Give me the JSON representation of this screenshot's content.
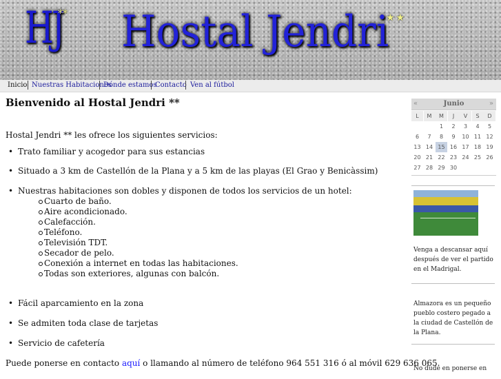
{
  "header": {
    "logo_mark": "HJ",
    "logo_stars": "**",
    "title": "Hostal Jendri",
    "title_stars": "★★"
  },
  "nav": {
    "items": [
      {
        "label": "Inicio",
        "current": true
      },
      {
        "label": "Nuestras Habitaciones",
        "current": false
      },
      {
        "label": "Dónde estamos",
        "current": false
      },
      {
        "label": "Contacto",
        "current": false
      },
      {
        "label": "Ven al fútbol",
        "current": false
      }
    ]
  },
  "main": {
    "title": "Bienvenido al Hostal Jendri **",
    "intro": "Hostal Jendri ** les ofrece los siguientes servicios:",
    "services": [
      "Trato familiar y acogedor para sus estancias",
      "Situado a 3 km de Castellón de la Plana y a 5 km de las playas (El Grao y Benicàssim)",
      "Nuestras habitaciones son dobles y disponen de todos los servicios de un hotel:",
      "Fácil aparcamiento en la zona",
      "Se admiten toda clase de tarjetas",
      "Servicio de cafetería"
    ],
    "room_features": [
      "Cuarto de baño.",
      "Aire acondicionado.",
      "Calefacción.",
      "Teléfono.",
      "Televisión TDT.",
      "Secador de pelo.",
      "Conexión a internet en todas las habitaciones.",
      "Todas son exteriores, algunas con balcón."
    ],
    "contact_before": "Puede ponerse en contacto ",
    "contact_link": "aquí",
    "contact_after": " o llamando al número de teléfono 964 551 316 ó al móvil 629 636 065."
  },
  "calendar": {
    "prev": "«",
    "next": "»",
    "month": "Junio",
    "weekdays": [
      "L",
      "M",
      "M",
      "J",
      "V",
      "S",
      "D"
    ],
    "weeks": [
      [
        "",
        "",
        "",
        "1",
        "2",
        "3",
        "4",
        "5"
      ],
      [
        "6",
        "7",
        "8",
        "9",
        "10",
        "11",
        "12"
      ],
      [
        "13",
        "14",
        "15",
        "16",
        "17",
        "18",
        "19"
      ],
      [
        "20",
        "21",
        "22",
        "23",
        "24",
        "25",
        "26"
      ],
      [
        "27",
        "28",
        "29",
        "30",
        "",
        "",
        ""
      ]
    ],
    "today": "15"
  },
  "sidebar": {
    "block1": "Venga a descansar aquí después de ver el partido en el Madrigal.",
    "block2": "Almazora es un pequeño pueblo costero pegado a la ciudad de Castellón de la Plana.",
    "block3": "No dude en ponerse en"
  }
}
